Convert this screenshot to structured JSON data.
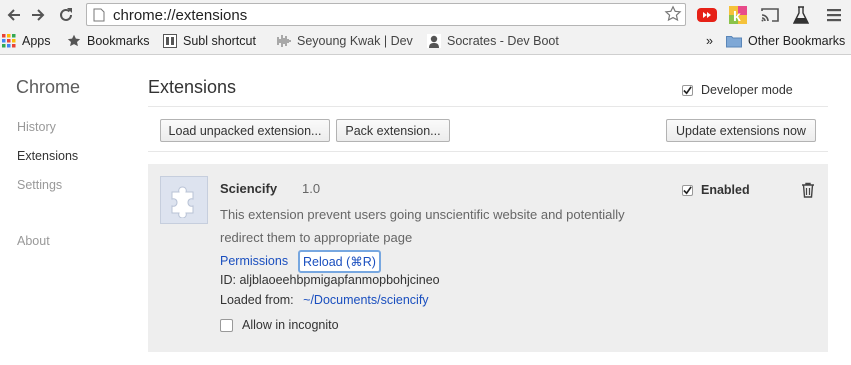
{
  "toolbar": {
    "url": "chrome://extensions",
    "extension_icons": [
      "youtube-icon",
      "k-extension-icon",
      "cast-icon",
      "lab-flask-icon",
      "menu-icon"
    ]
  },
  "bookmarks": {
    "apps": "Apps",
    "bookmarks": "Bookmarks",
    "subl": "Subl shortcut",
    "seyoung": "Seyoung Kwak | Dev",
    "socrates": "Socrates - Dev Boot",
    "overflow": "»",
    "other": "Other Bookmarks"
  },
  "sidebar": {
    "title": "Chrome",
    "items": [
      {
        "label": "History"
      },
      {
        "label": "Extensions"
      },
      {
        "label": "Settings"
      },
      {
        "label": "About"
      }
    ]
  },
  "main": {
    "title": "Extensions",
    "developer_mode_label": "Developer mode",
    "developer_mode_checked": true,
    "buttons": {
      "load_unpacked": "Load unpacked extension...",
      "pack": "Pack extension...",
      "update": "Update extensions now"
    }
  },
  "extension": {
    "name": "Sciencify",
    "version": "1.0",
    "description": "This extension prevent users going unscientific website and potentially redirect them to appropriate page",
    "permissions_link": "Permissions",
    "reload_link": "Reload (⌘R)",
    "id_label": "ID:",
    "id_value": "aljblaoeehbpmigapfanmopbohjcineo",
    "loaded_from_label": "Loaded from:",
    "loaded_from_path": "~/Documents/sciencify",
    "enabled_label": "Enabled",
    "enabled_checked": true,
    "incognito_label": "Allow in incognito",
    "incognito_checked": false
  },
  "colors": {
    "link": "#1a4fbf",
    "card_bg": "#eeeeee",
    "toolbar_bg": "#f2f2f2"
  }
}
